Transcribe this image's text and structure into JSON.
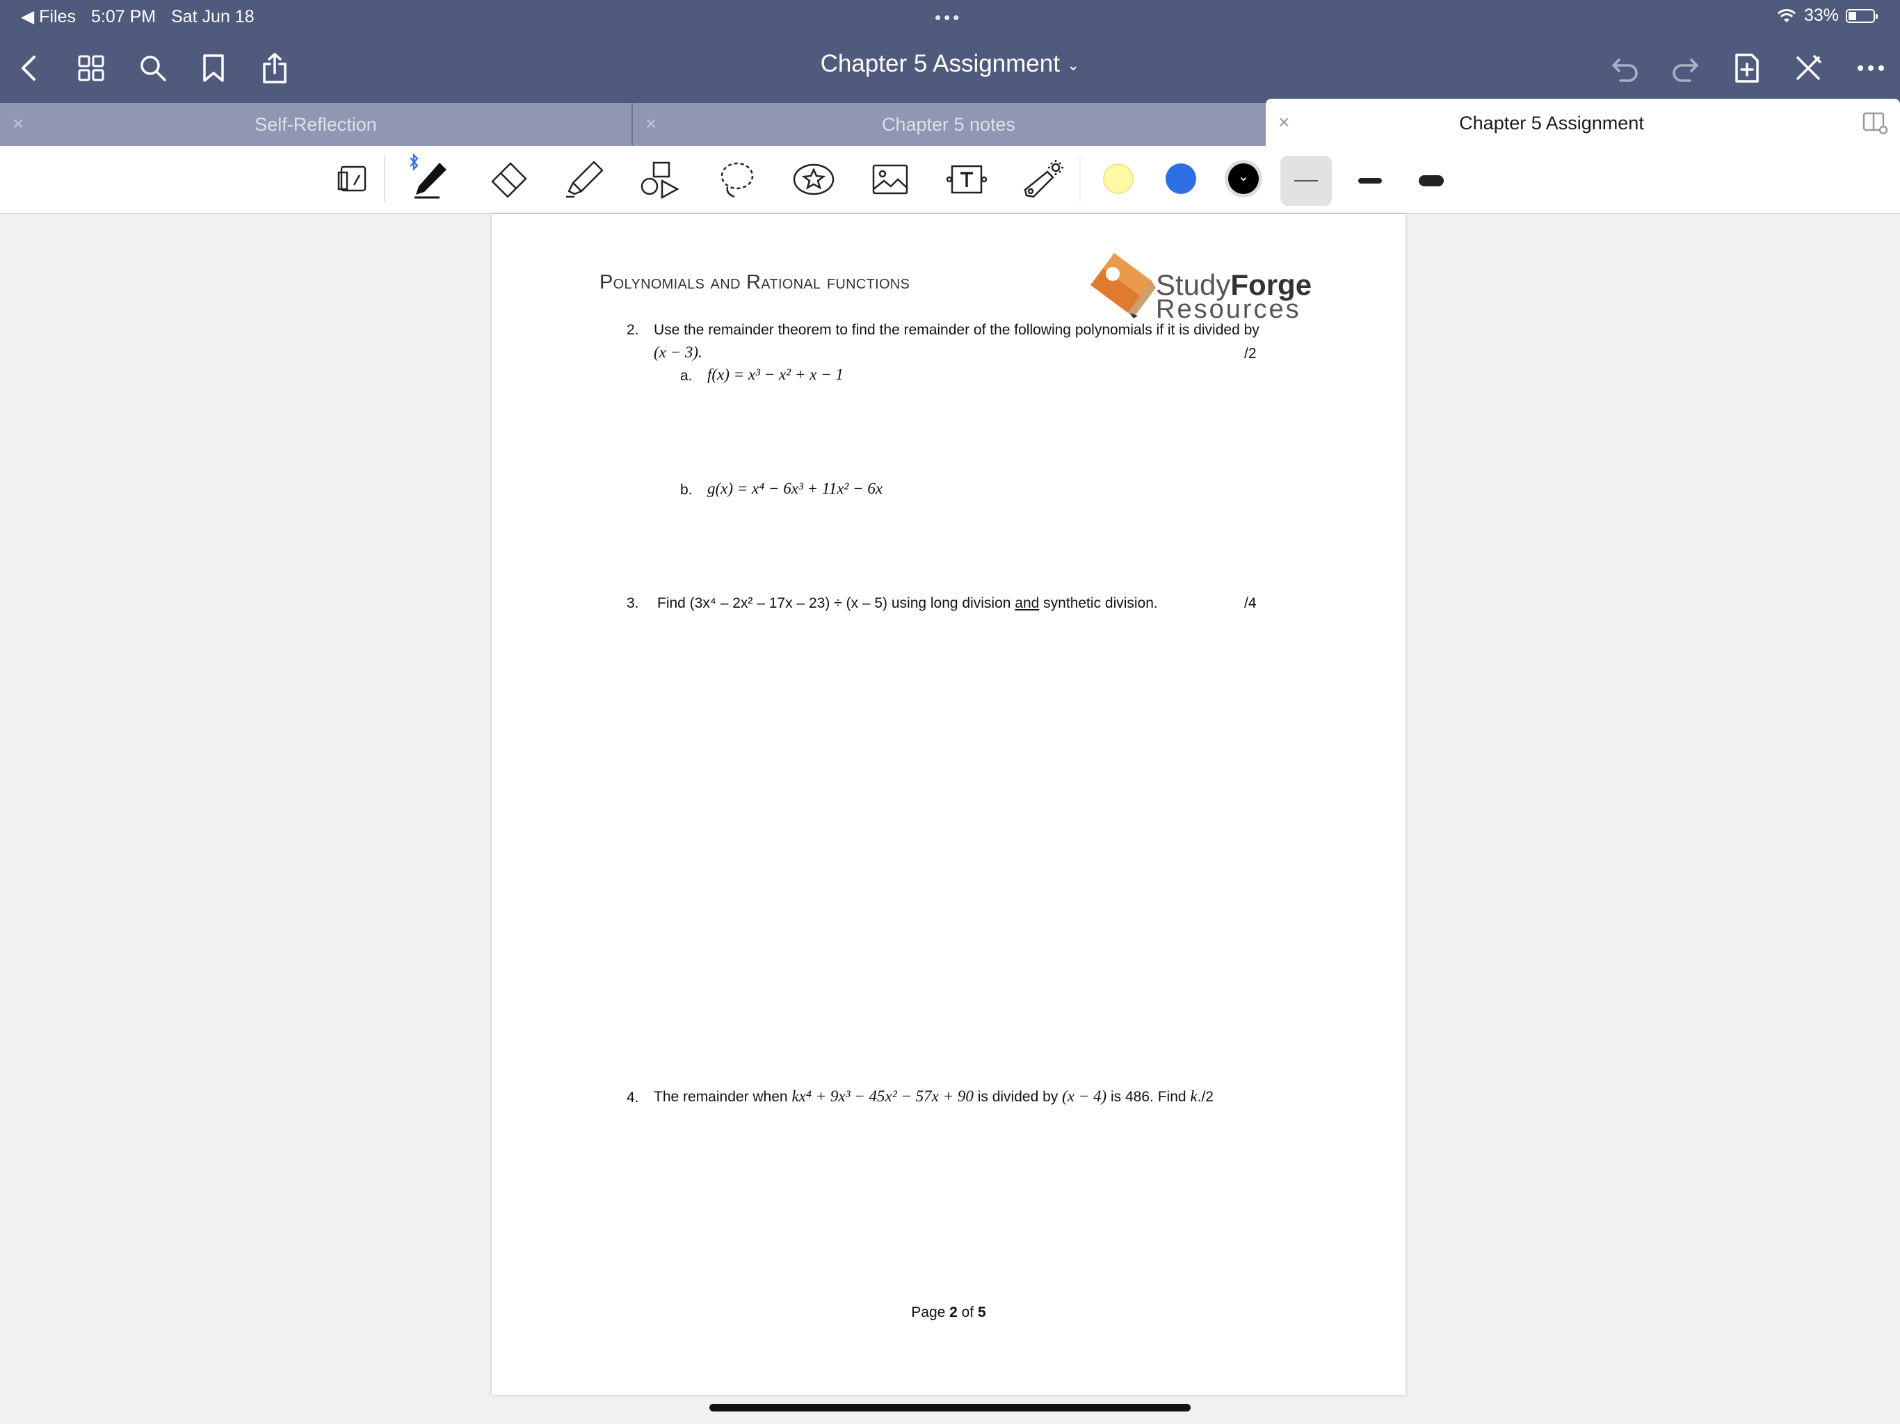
{
  "status": {
    "back_app": "Files",
    "time": "5:07 PM",
    "date": "Sat Jun 18",
    "battery": "33%",
    "battery_level": 0.33
  },
  "nav": {
    "title": "Chapter 5 Assignment"
  },
  "tabs": [
    {
      "label": "Self-Reflection",
      "active": false
    },
    {
      "label": "Chapter 5 notes",
      "active": false
    },
    {
      "label": "Chapter 5 Assignment",
      "active": true
    }
  ],
  "toolbar": {
    "colors": [
      "#fff9a6",
      "#2f6fe4",
      "#000000"
    ],
    "selected_color": "#000000"
  },
  "document": {
    "heading": "Polynomials and Rational functions",
    "logo_study": "Study",
    "logo_forge": "Forge",
    "logo_resources": "Resources",
    "q2_num": "2.",
    "q2_text": "Use the remainder theorem to find the remainder of the following polynomials if it is divided by",
    "q2_divisor": "(x − 3).",
    "q2_points": "/2",
    "q2a_label": "a.",
    "q2a_expr": "f(x) = x³ − x² + x − 1",
    "q2b_label": "b.",
    "q2b_expr": "g(x) = x⁴ − 6x³ + 11x² − 6x",
    "q3_num": "3.",
    "q3_text_before": "Find (3x⁴ – 2x² – 17x – 23) ÷ (x – 5) using long division ",
    "q3_and": "and",
    "q3_text_after": " synthetic division.",
    "q3_points": "/4",
    "q4_num": "4.",
    "q4_text1": "The remainder when ",
    "q4_expr": "kx⁴ + 9x³ − 45x² − 57x + 90",
    "q4_text2": " is divided by ",
    "q4_divisor": "(x − 4)",
    "q4_text3": " is 486. Find ",
    "q4_k": "k",
    "q4_text4": "./2",
    "page_prefix": "Page ",
    "page_current": "2",
    "page_mid": " of ",
    "page_total": "5"
  }
}
